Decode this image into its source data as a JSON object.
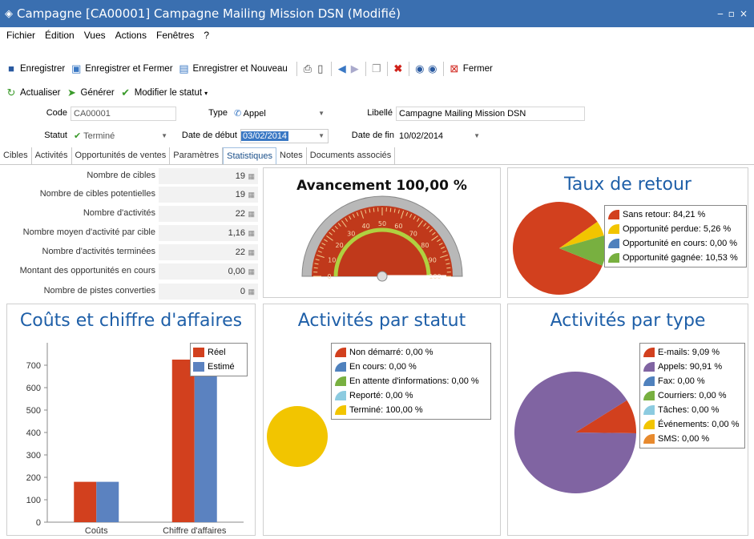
{
  "window": {
    "title": "Campagne [CA00001] Campagne Mailing Mission DSN (Modifié)",
    "min": "‒",
    "max": "▫",
    "close": "×"
  },
  "menu": [
    "Fichier",
    "Édition",
    "Vues",
    "Actions",
    "Fenêtres",
    "?"
  ],
  "toolbar1": {
    "save": "Enregistrer",
    "save_close": "Enregistrer et Fermer",
    "save_new": "Enregistrer et Nouveau",
    "close": "Fermer"
  },
  "toolbar2": {
    "refresh": "Actualiser",
    "generate": "Générer",
    "change_status": "Modifier le statut"
  },
  "form": {
    "code_label": "Code",
    "code_value": "CA00001",
    "type_label": "Type",
    "type_value": "Appel",
    "libelle_label": "Libellé",
    "libelle_value": "Campagne Mailing Mission DSN",
    "statut_label": "Statut",
    "statut_value": "Terminé",
    "date_debut_label": "Date de début",
    "date_debut_value": "03/02/2014",
    "date_fin_label": "Date de fin",
    "date_fin_value": "10/02/2014"
  },
  "tabs": [
    "Cibles",
    "Activités",
    "Opportunités de ventes",
    "Paramètres",
    "Statistiques",
    "Notes",
    "Documents associés"
  ],
  "active_tab": "Statistiques",
  "stats": [
    {
      "label": "Nombre de cibles",
      "value": "19"
    },
    {
      "label": "Nombre de cibles potentielles",
      "value": "19"
    },
    {
      "label": "Nombre d'activités",
      "value": "22"
    },
    {
      "label": "Nombre moyen d'activité par cible",
      "value": "1,16"
    },
    {
      "label": "Nombre d'activités terminées",
      "value": "22"
    },
    {
      "label": "Montant des opportunités en cours",
      "value": "0,00"
    },
    {
      "label": "Nombre de pistes converties",
      "value": "0"
    }
  ],
  "gauge": {
    "title": "Avancement 100,00 %",
    "value": 100,
    "ticks": [
      "0",
      "10",
      "20",
      "30",
      "40",
      "50",
      "60",
      "70",
      "80",
      "90",
      "100"
    ]
  },
  "taux": {
    "title": "Taux de retour",
    "items": [
      {
        "label": "Sans retour: 84,21 %",
        "value": 84.21,
        "color": "#d2401e"
      },
      {
        "label": "Opportunité perdue: 5,26 %",
        "value": 5.26,
        "color": "#f2c500"
      },
      {
        "label": "Opportunité en cours: 0,00 %",
        "value": 0,
        "color": "#4f81bd"
      },
      {
        "label": "Opportunité gagnée: 10,53 %",
        "value": 10.53,
        "color": "#78b040"
      }
    ]
  },
  "chart_data": [
    {
      "type": "bar",
      "title": "Coûts et chiffre d'affaires",
      "categories": [
        "Coûts",
        "Chiffre d'affaires"
      ],
      "series": [
        {
          "name": "Réel",
          "values": [
            180,
            725
          ],
          "color": "#d2401e"
        },
        {
          "name": "Estimé",
          "values": [
            180,
            725
          ],
          "color": "#5b82c0"
        }
      ],
      "yticks": [
        "0",
        "100",
        "200",
        "300",
        "400",
        "500",
        "600",
        "700"
      ],
      "ylim": [
        0,
        800
      ],
      "grid": false,
      "legend": "top-right"
    },
    {
      "type": "pie",
      "title": "Activités par statut",
      "items": [
        {
          "label": "Non démarré: 0,00 %",
          "value": 0,
          "color": "#d2401e"
        },
        {
          "label": "En cours: 0,00 %",
          "value": 0,
          "color": "#4f81bd"
        },
        {
          "label": "En attente d'informations: 0,00 %",
          "value": 0,
          "color": "#78b040"
        },
        {
          "label": "Reporté: 0,00 %",
          "value": 0,
          "color": "#8ccbe0"
        },
        {
          "label": "Terminé: 100,00 %",
          "value": 100,
          "color": "#f2c500"
        }
      ]
    },
    {
      "type": "pie",
      "title": "Activités par type",
      "items": [
        {
          "label": "E-mails: 9,09 %",
          "value": 9.09,
          "color": "#d2401e"
        },
        {
          "label": "Appels: 90,91 %",
          "value": 90.91,
          "color": "#8064a2"
        },
        {
          "label": "Fax: 0,00 %",
          "value": 0,
          "color": "#4f81bd"
        },
        {
          "label": "Courriers: 0,00 %",
          "value": 0,
          "color": "#78b040"
        },
        {
          "label": "Tâches: 0,00 %",
          "value": 0,
          "color": "#8ccbe0"
        },
        {
          "label": "Événements: 0,00 %",
          "value": 0,
          "color": "#f2c500"
        },
        {
          "label": "SMS: 0,00 %",
          "value": 0,
          "color": "#e88a2e"
        }
      ]
    }
  ]
}
